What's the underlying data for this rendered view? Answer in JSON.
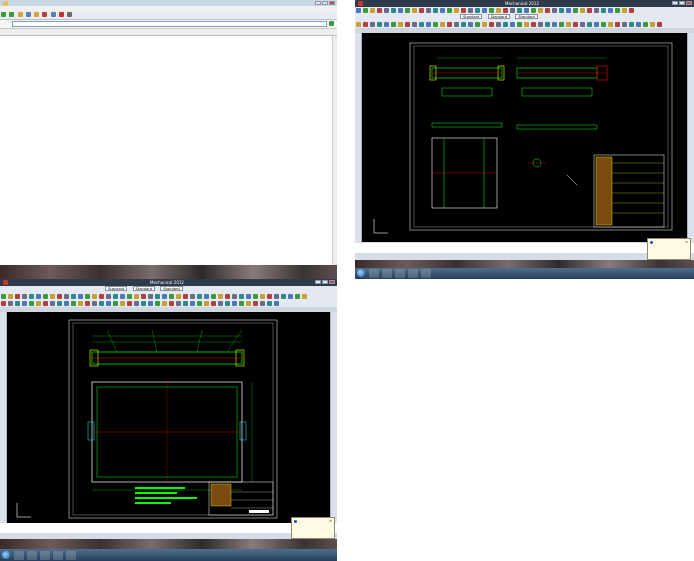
{
  "explorer": {
    "title": "",
    "menu": [],
    "address": "",
    "columns": [],
    "files": []
  },
  "cad_right": {
    "title": "Mechanical 2012",
    "tab_label": "",
    "toolbar_combos": [
      "Standard",
      "Standard",
      "Standard"
    ],
    "command_lines": [
      "",
      ""
    ],
    "notification": {
      "title": "",
      "body": "",
      "link": ""
    },
    "clock": {
      "time": "",
      "date": ""
    }
  },
  "cad_bottom": {
    "title": "Mechanical 2012",
    "tab_label": "",
    "toolbar_combos": [
      "Standard",
      "Standard",
      "Standard"
    ],
    "command_lines": [
      "",
      ""
    ],
    "notification": {
      "title": "",
      "body": "",
      "link": ""
    },
    "clock": {
      "time": "",
      "date": ""
    }
  },
  "colors": {
    "cad_bg": "#000000",
    "cad_green": "#00ff00",
    "cad_yellow": "#ffff00",
    "cad_red": "#ff0000",
    "cad_cyan": "#00ffff",
    "cad_white": "#ffffff",
    "cad_blue": "#3b6bff"
  }
}
